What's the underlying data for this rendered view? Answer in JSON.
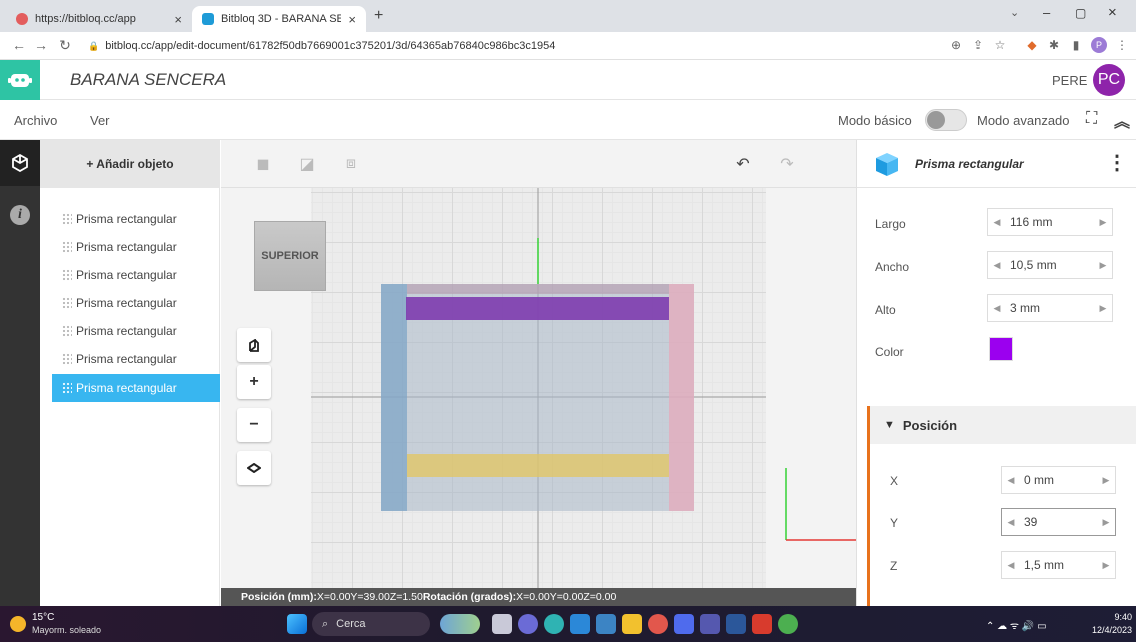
{
  "browser": {
    "tabs": [
      {
        "title": "https://bitbloq.cc/app",
        "active": false
      },
      {
        "title": "Bitbloq 3D - BARANA SENCERA",
        "active": true
      }
    ],
    "new_tab": "+",
    "url": "bitbloq.cc/app/edit-document/61782f50db7669001c375201/3d/64365ab76840c986bc3c1954",
    "profile_initial": "P"
  },
  "app": {
    "document_title": "BARANA SENCERA",
    "user_name": "PERE",
    "user_initials": "PC"
  },
  "menubar": {
    "menus": [
      "Archivo",
      "Ver"
    ],
    "mode_basic": "Modo básico",
    "mode_advanced": "Modo avanzado",
    "mode_advanced_on": false
  },
  "objects": {
    "add_label": "+ Añadir objeto",
    "items": [
      {
        "label": "Prisma rectangular",
        "selected": false
      },
      {
        "label": "Prisma rectangular",
        "selected": false
      },
      {
        "label": "Prisma rectangular",
        "selected": false
      },
      {
        "label": "Prisma rectangular",
        "selected": false
      },
      {
        "label": "Prisma rectangular",
        "selected": false
      },
      {
        "label": "Prisma rectangular",
        "selected": false
      },
      {
        "label": "Prisma rectangular",
        "selected": true
      }
    ]
  },
  "viewport": {
    "view_cube_label": "SUPERIOR",
    "controls": [
      "perspective-icon",
      "zoom-in-icon",
      "zoom-out-icon",
      "fit-view-icon"
    ]
  },
  "statusbar": {
    "position_label": "Posición (mm):",
    "pos_x": "X=0.00",
    "pos_y": "Y=39.00",
    "pos_z": "Z=1.50",
    "rotation_label": "Rotación (grados):",
    "rot_x": "X=0.00",
    "rot_y": "Y=0.00",
    "rot_z": "Z=0.00"
  },
  "properties": {
    "title": "Prisma rectangular",
    "fields": [
      {
        "label": "Largo",
        "value": "116 mm"
      },
      {
        "label": "Ancho",
        "value": "10,5 mm"
      },
      {
        "label": "Alto",
        "value": "3 mm"
      }
    ],
    "color_label": "Color",
    "color_value": "#9b00ef",
    "position_section": "Posición",
    "position_fields": [
      {
        "label": "X",
        "value": "0 mm"
      },
      {
        "label": "Y",
        "value": "39"
      },
      {
        "label": "Z",
        "value": "1,5 mm"
      }
    ]
  },
  "taskbar": {
    "weather_temp": "15°C",
    "weather_text": "Mayorm. soleado",
    "search_placeholder": "Cerca",
    "time": "9:40",
    "date": "12/4/2023"
  }
}
